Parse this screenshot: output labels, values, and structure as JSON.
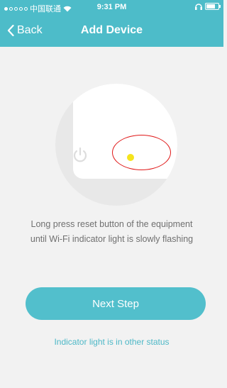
{
  "status_bar": {
    "carrier": "中国联通",
    "time": "9:31 PM"
  },
  "nav": {
    "back_label": "Back",
    "title": "Add Device"
  },
  "illustration": {
    "indicator_color": "#f5e41d",
    "highlight_color": "#e01818"
  },
  "instructions": {
    "line1": "Long press reset button of the equipment",
    "line2": "until Wi-Fi indicator light is slowly flashing"
  },
  "next_button": {
    "label": "Next Step",
    "color": "#52bfcc"
  },
  "other_status_link": {
    "label": "Indicator light is in other status",
    "color": "#4db8c7"
  },
  "colors": {
    "header": "#4dbcc9"
  }
}
